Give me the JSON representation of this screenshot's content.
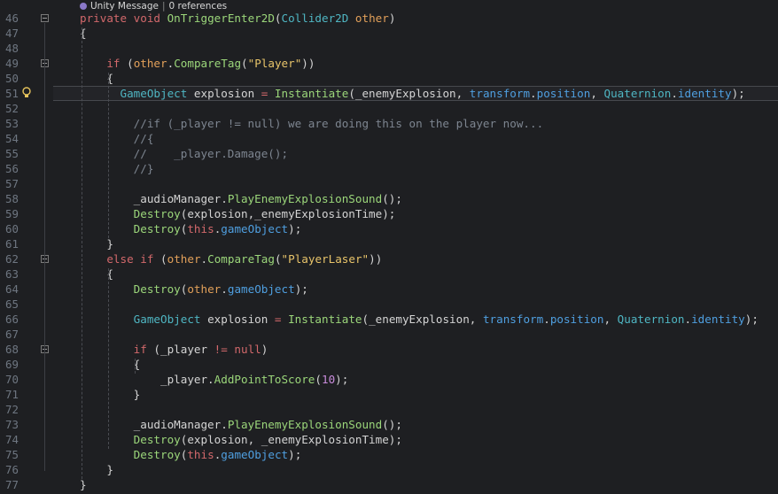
{
  "editor": {
    "codelens": {
      "label": "Unity Message",
      "refs": "0 references"
    },
    "colors": {
      "background": "#1e1f22",
      "keyword": "#d2686b",
      "type": "#4fb6c3",
      "method": "#9bd67a",
      "string": "#e8c46a",
      "comment": "#7d8590",
      "property": "#4f9fe0",
      "number": "#c88bdb"
    },
    "highlighted_line": "51",
    "lines": [
      {
        "n": "46",
        "tokens": [
          [
            "kw",
            "private "
          ],
          [
            "kw",
            "void "
          ],
          [
            "meth",
            "OnTriggerEnter2D"
          ],
          [
            "mem",
            "("
          ],
          [
            "type",
            "Collider2D "
          ],
          [
            "param",
            "other"
          ],
          [
            "mem",
            ")"
          ]
        ]
      },
      {
        "n": "47",
        "tokens": [
          [
            "mem",
            "{"
          ]
        ]
      },
      {
        "n": "48",
        "tokens": []
      },
      {
        "n": "49",
        "tokens": [
          [
            "mem",
            "    "
          ],
          [
            "kw",
            "if "
          ],
          [
            "mem",
            "("
          ],
          [
            "param",
            "other"
          ],
          [
            "mem",
            "."
          ],
          [
            "meth",
            "CompareTag"
          ],
          [
            "mem",
            "("
          ],
          [
            "str",
            "\"Player\""
          ],
          [
            "mem",
            "))"
          ]
        ]
      },
      {
        "n": "50",
        "tokens": [
          [
            "mem",
            "    {"
          ]
        ]
      },
      {
        "n": "51",
        "tokens": [
          [
            "mem",
            "      "
          ],
          [
            "type",
            "GameObject "
          ],
          [
            "mem",
            "explosion "
          ],
          [
            "kw",
            "= "
          ],
          [
            "meth",
            "Instantiate"
          ],
          [
            "mem",
            "(_enemyExplosion, "
          ],
          [
            "prop",
            "transform"
          ],
          [
            "mem",
            "."
          ],
          [
            "prop",
            "position"
          ],
          [
            "mem",
            ", "
          ],
          [
            "type",
            "Quaternion"
          ],
          [
            "mem",
            "."
          ],
          [
            "prop",
            "identity"
          ],
          [
            "mem",
            ");"
          ]
        ]
      },
      {
        "n": "52",
        "tokens": []
      },
      {
        "n": "53",
        "tokens": [
          [
            "cm",
            "        //if (_player != null) we are doing this on the player now..."
          ]
        ]
      },
      {
        "n": "54",
        "tokens": [
          [
            "cm",
            "        //{"
          ]
        ]
      },
      {
        "n": "55",
        "tokens": [
          [
            "cm",
            "        //    _player.Damage();"
          ]
        ]
      },
      {
        "n": "56",
        "tokens": [
          [
            "cm",
            "        //}"
          ]
        ]
      },
      {
        "n": "57",
        "tokens": []
      },
      {
        "n": "58",
        "tokens": [
          [
            "mem",
            "        _audioManager."
          ],
          [
            "meth",
            "PlayEnemyExplosionSound"
          ],
          [
            "mem",
            "();"
          ]
        ]
      },
      {
        "n": "59",
        "tokens": [
          [
            "mem",
            "        "
          ],
          [
            "meth",
            "Destroy"
          ],
          [
            "mem",
            "(explosion,_enemyExplosionTime);"
          ]
        ]
      },
      {
        "n": "60",
        "tokens": [
          [
            "mem",
            "        "
          ],
          [
            "meth",
            "Destroy"
          ],
          [
            "mem",
            "("
          ],
          [
            "kw",
            "this"
          ],
          [
            "mem",
            "."
          ],
          [
            "prop",
            "gameObject"
          ],
          [
            "mem",
            ");"
          ]
        ]
      },
      {
        "n": "61",
        "tokens": [
          [
            "mem",
            "    }"
          ]
        ]
      },
      {
        "n": "62",
        "tokens": [
          [
            "mem",
            "    "
          ],
          [
            "kw",
            "else if "
          ],
          [
            "mem",
            "("
          ],
          [
            "param",
            "other"
          ],
          [
            "mem",
            "."
          ],
          [
            "meth",
            "CompareTag"
          ],
          [
            "mem",
            "("
          ],
          [
            "str",
            "\"PlayerLaser\""
          ],
          [
            "mem",
            "))"
          ]
        ]
      },
      {
        "n": "63",
        "tokens": [
          [
            "mem",
            "    {"
          ]
        ]
      },
      {
        "n": "64",
        "tokens": [
          [
            "mem",
            "        "
          ],
          [
            "meth",
            "Destroy"
          ],
          [
            "mem",
            "("
          ],
          [
            "param",
            "other"
          ],
          [
            "mem",
            "."
          ],
          [
            "prop",
            "gameObject"
          ],
          [
            "mem",
            ");"
          ]
        ]
      },
      {
        "n": "65",
        "tokens": []
      },
      {
        "n": "66",
        "tokens": [
          [
            "mem",
            "        "
          ],
          [
            "type",
            "GameObject "
          ],
          [
            "mem",
            "explosion "
          ],
          [
            "kw",
            "= "
          ],
          [
            "meth",
            "Instantiate"
          ],
          [
            "mem",
            "(_enemyExplosion, "
          ],
          [
            "prop",
            "transform"
          ],
          [
            "mem",
            "."
          ],
          [
            "prop",
            "position"
          ],
          [
            "mem",
            ", "
          ],
          [
            "type",
            "Quaternion"
          ],
          [
            "mem",
            "."
          ],
          [
            "prop",
            "identity"
          ],
          [
            "mem",
            ");"
          ]
        ]
      },
      {
        "n": "67",
        "tokens": []
      },
      {
        "n": "68",
        "tokens": [
          [
            "mem",
            "        "
          ],
          [
            "kw",
            "if "
          ],
          [
            "mem",
            "(_player "
          ],
          [
            "kw",
            "!= null"
          ],
          [
            "mem",
            ")"
          ]
        ]
      },
      {
        "n": "69",
        "tokens": [
          [
            "mem",
            "        {"
          ]
        ]
      },
      {
        "n": "70",
        "tokens": [
          [
            "mem",
            "            _player."
          ],
          [
            "meth",
            "AddPointToScore"
          ],
          [
            "mem",
            "("
          ],
          [
            "num",
            "10"
          ],
          [
            "mem",
            ");"
          ]
        ]
      },
      {
        "n": "71",
        "tokens": [
          [
            "mem",
            "        }"
          ]
        ]
      },
      {
        "n": "72",
        "tokens": []
      },
      {
        "n": "73",
        "tokens": [
          [
            "mem",
            "        _audioManager."
          ],
          [
            "meth",
            "PlayEnemyExplosionSound"
          ],
          [
            "mem",
            "();"
          ]
        ]
      },
      {
        "n": "74",
        "tokens": [
          [
            "mem",
            "        "
          ],
          [
            "meth",
            "Destroy"
          ],
          [
            "mem",
            "(explosion, _enemyExplosionTime);"
          ]
        ]
      },
      {
        "n": "75",
        "tokens": [
          [
            "mem",
            "        "
          ],
          [
            "meth",
            "Destroy"
          ],
          [
            "mem",
            "("
          ],
          [
            "kw",
            "this"
          ],
          [
            "mem",
            "."
          ],
          [
            "prop",
            "gameObject"
          ],
          [
            "mem",
            ");"
          ]
        ]
      },
      {
        "n": "76",
        "tokens": [
          [
            "mem",
            "    }"
          ]
        ]
      },
      {
        "n": "77",
        "tokens": [
          [
            "mem",
            "}"
          ]
        ]
      }
    ],
    "folds": [
      "46",
      "49",
      "62",
      "68"
    ],
    "lightbulb_line": "51"
  }
}
